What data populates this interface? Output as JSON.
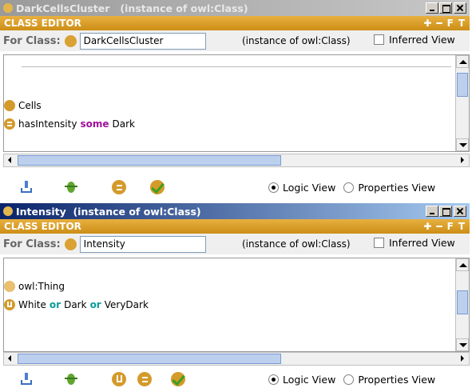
{
  "windows": [
    {
      "title": "DarkCellsCluster   (instance of owl:Class)",
      "active": false,
      "editor_label": "CLASS EDITOR",
      "editor_tools": [
        "✚",
        "━",
        "F",
        "T"
      ],
      "for_class_label": "For Class:",
      "class_name": "DarkCellsCluster",
      "instance_text": "(instance of owl:Class)",
      "inferred_view_label": "Inferred View",
      "rows": [
        {
          "type": "superclass",
          "text": "Cells"
        },
        {
          "type": "restriction",
          "property": "hasIntensity",
          "keyword": "some",
          "filler": "Dark"
        }
      ],
      "logic_view_label": "Logic View",
      "properties_view_label": "Properties View",
      "selected_view": "Logic View"
    },
    {
      "title": "Intensity  (instance of owl:Class)",
      "active": true,
      "editor_label": "CLASS EDITOR",
      "editor_tools": [
        "✚",
        "━",
        "F",
        "T"
      ],
      "for_class_label": "For Class:",
      "class_name": "Intensity",
      "instance_text": "(instance of owl:Class)",
      "inferred_view_label": "Inferred View",
      "rows": [
        {
          "type": "superclass",
          "text": "owl:Thing"
        },
        {
          "type": "union",
          "items": [
            "White",
            "Dark",
            "VeryDark"
          ],
          "keyword": "or"
        }
      ],
      "logic_view_label": "Logic View",
      "properties_view_label": "Properties View",
      "selected_view": "Logic View"
    }
  ],
  "icons": {
    "add": "add-superclass-icon",
    "bug": "check-consistency-icon",
    "equivalent": "equivalent-class-icon",
    "union": "union-class-icon",
    "checkmark": "classify-icon"
  },
  "colors": {
    "editor_bar": "#d9a232",
    "class_dot": "#d49a2a",
    "keyword_some": "#a0109a",
    "keyword_or": "#0a9a9a",
    "active_title": "#0a246a"
  }
}
